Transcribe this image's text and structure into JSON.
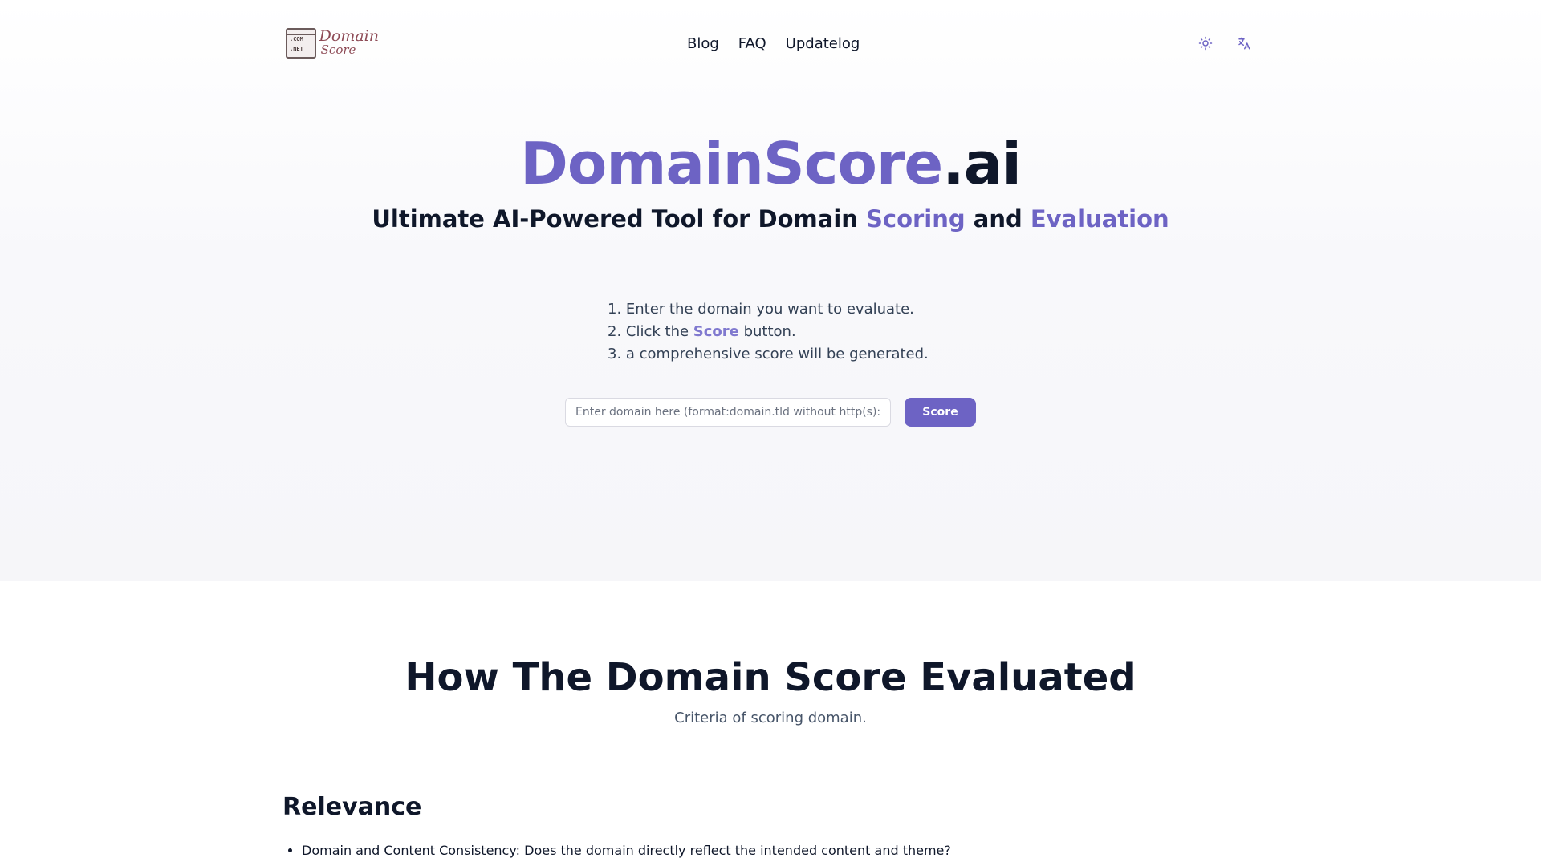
{
  "header": {
    "logo_tag_com": ".COM",
    "logo_tag_net": ".NET",
    "logo_word1": "Domain",
    "logo_word2": "Score",
    "nav": [
      {
        "label": "Blog"
      },
      {
        "label": "FAQ"
      },
      {
        "label": "Updatelog"
      }
    ],
    "icons": [
      "sun-icon",
      "translate-icon"
    ]
  },
  "hero": {
    "brand_main": "DomainScore",
    "brand_suffix": ".ai",
    "tagline_part1": "Ultimate AI-Powered Tool for Domain ",
    "tagline_hl1": "Scoring",
    "tagline_part2": " and ",
    "tagline_hl2": "Evaluation",
    "steps": {
      "step1": "1. Enter the domain you want to evaluate.",
      "step2_prefix": "2. Click the ",
      "step2_bold": "Score",
      "step2_suffix": " button.",
      "step3": "3. a comprehensive score will be generated."
    },
    "input_placeholder": "Enter domain here (format:domain.tld without http(s)://)",
    "input_value": "",
    "score_button": "Score"
  },
  "criteria": {
    "title": "How The Domain Score Evaluated",
    "subtitle": "Criteria of scoring domain.",
    "sections": [
      {
        "title": "Relevance",
        "items": [
          "Domain and Content Consistency: Does the domain directly reflect the intended content and theme?"
        ]
      }
    ]
  },
  "colors": {
    "accent": "#6d63c4",
    "text": "#0f172a",
    "muted": "#475569"
  }
}
